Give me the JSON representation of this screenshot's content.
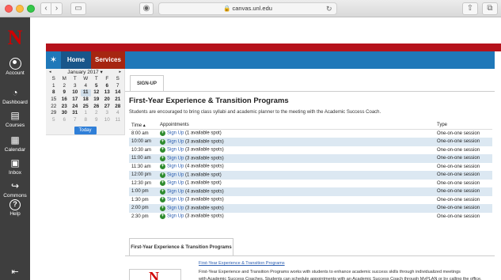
{
  "browser": {
    "address": "canvas.unl.edu",
    "back_icon": "chevron-left-icon",
    "forward_icon": "chevron-right-icon"
  },
  "global_nav": {
    "items": [
      {
        "label": "Account",
        "icon": "user-circle-icon"
      },
      {
        "label": "Dashboard",
        "icon": "gauge-icon"
      },
      {
        "label": "Courses",
        "icon": "book-icon"
      },
      {
        "label": "Calendar",
        "icon": "calendar-icon"
      },
      {
        "label": "Inbox",
        "icon": "inbox-icon"
      },
      {
        "label": "Commons",
        "icon": "commons-icon"
      },
      {
        "label": "Help",
        "icon": "help-icon"
      }
    ]
  },
  "tabs": {
    "home": "Home",
    "services": "Services"
  },
  "calendar": {
    "month": "January 2017 ▾",
    "prev": "◂",
    "next": "▸",
    "dow": [
      "S",
      "M",
      "T",
      "W",
      "T",
      "F",
      "S"
    ],
    "weeks": [
      [
        "1",
        "2",
        "3",
        "4",
        "5",
        "6",
        "7"
      ],
      [
        "8",
        "9",
        "10",
        "11",
        "12",
        "13",
        "14"
      ],
      [
        "15",
        "16",
        "17",
        "18",
        "19",
        "20",
        "21"
      ],
      [
        "22",
        "23",
        "24",
        "25",
        "26",
        "27",
        "28"
      ],
      [
        "29",
        "30",
        "31",
        "1",
        "2",
        "3",
        "4"
      ],
      [
        "5",
        "6",
        "7",
        "8",
        "9",
        "10",
        "11"
      ]
    ],
    "today_label": "Today"
  },
  "content": {
    "signup_tab": "SIGN-UP",
    "title": "First-Year Experience & Transition Programs",
    "subtitle": "Students are encouraged to bring class syllabi and academic planner to the meeting with the Academic Success Coach.",
    "columns": {
      "time": "Time ▴",
      "appointments": "Appointments",
      "type": "Type"
    },
    "sign_up_label": "Sign Up",
    "rows": [
      {
        "time": "8:00 am",
        "spots": "(1 available spot)",
        "type": "One-on-one session"
      },
      {
        "time": "10:00 am",
        "spots": "(3 available spots)",
        "type": "One-on-one session"
      },
      {
        "time": "10:30 am",
        "spots": "(3 available spots)",
        "type": "One-on-one session"
      },
      {
        "time": "11:00 am",
        "spots": "(3 available spots)",
        "type": "One-on-one session"
      },
      {
        "time": "11:30 am",
        "spots": "(4 available spots)",
        "type": "One-on-one session"
      },
      {
        "time": "12:00 pm",
        "spots": "(1 available spot)",
        "type": "One-on-one session"
      },
      {
        "time": "12:30 pm",
        "spots": "(1 available spot)",
        "type": "One-on-one session"
      },
      {
        "time": "1:00 pm",
        "spots": "(4 available spots)",
        "type": "One-on-one session"
      },
      {
        "time": "1:30 pm",
        "spots": "(3 available spots)",
        "type": "One-on-one session"
      },
      {
        "time": "2:00 pm",
        "spots": "(3 available spots)",
        "type": "One-on-one session"
      },
      {
        "time": "2:30 pm",
        "spots": "(3 available spots)",
        "type": "One-on-one session"
      }
    ],
    "fy_tab": "First-Year Experience & Transition Programs",
    "fy_link": "First-Year Experience & Transition Programs",
    "fy_desc": "First-Year Experience and Transition Programs works with students to enhance academic success skills through individualized meetings",
    "fy_desc2": "with Academic Success Coaches. Students can schedule appointments with an Academic Success Coach through MyPLAN or by calling the office."
  }
}
